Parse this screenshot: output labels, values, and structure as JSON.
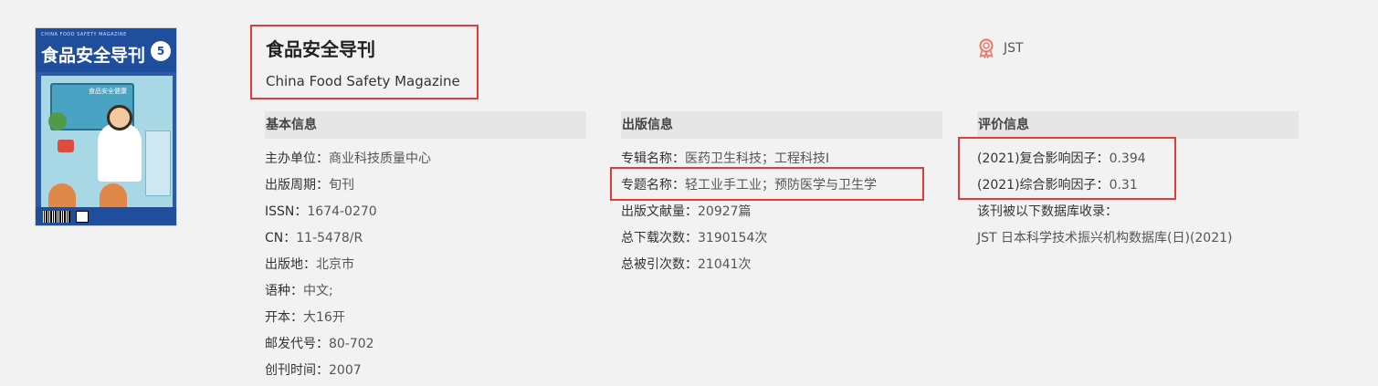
{
  "cover": {
    "title": "食品安全导刊",
    "small_text": "CHINA FOOD SAFETY MAGAZINE",
    "issue": "5",
    "board_text": "食品安全健康"
  },
  "journal": {
    "title_cn": "食品安全导刊",
    "title_en": "China Food Safety Magazine",
    "badge": "JST"
  },
  "basic": {
    "heading": "基本信息",
    "rows": [
      {
        "k": "主办单位：",
        "v": "商业科技质量中心"
      },
      {
        "k": "出版周期：",
        "v": "旬刊"
      },
      {
        "k": "ISSN：",
        "v": "1674-0270"
      },
      {
        "k": "CN：",
        "v": "11-5478/R"
      },
      {
        "k": "出版地：",
        "v": "北京市"
      },
      {
        "k": "语种：",
        "v": "中文;"
      },
      {
        "k": "开本：",
        "v": "大16开"
      },
      {
        "k": "邮发代号：",
        "v": "80-702"
      },
      {
        "k": "创刊时间：",
        "v": "2007"
      }
    ]
  },
  "publish": {
    "heading": "出版信息",
    "rows": [
      {
        "k": "专辑名称：",
        "v": "医药卫生科技；工程科技I"
      },
      {
        "k": "专题名称：",
        "v": "轻工业手工业；预防医学与卫生学"
      },
      {
        "k": "出版文献量：",
        "v": "20927篇"
      },
      {
        "k": "总下载次数：",
        "v": "3190154次"
      },
      {
        "k": "总被引次数：",
        "v": "21041次"
      }
    ]
  },
  "eval": {
    "heading": "评价信息",
    "rows": [
      {
        "k": "(2021)复合影响因子：",
        "v": "0.394"
      },
      {
        "k": "(2021)综合影响因子：",
        "v": "0.31"
      },
      {
        "k": "该刊被以下数据库收录：",
        "v": ""
      },
      {
        "k": "",
        "v": "JST 日本科学技术振兴机构数据库(日)(2021)"
      }
    ]
  },
  "colors": {
    "highlight": "#e5393a",
    "badge_icon": "#e8776a",
    "section_bg": "#e6e6e6"
  }
}
